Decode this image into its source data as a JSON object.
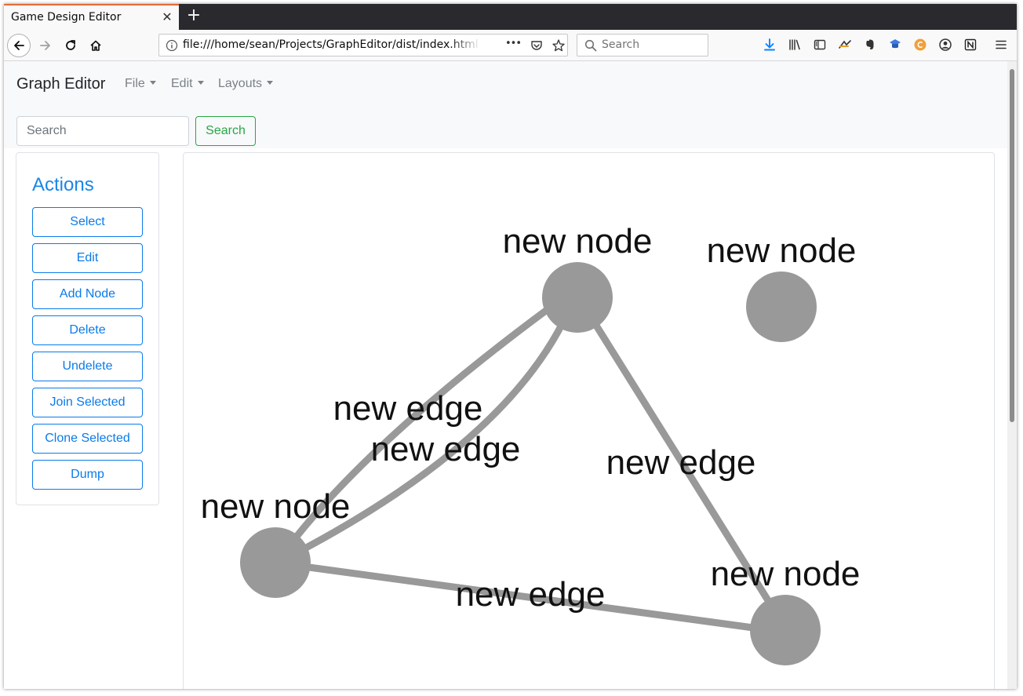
{
  "browser": {
    "tab_title": "Game Design Editor",
    "tab_close": "✕",
    "new_tab": "+",
    "url": "file:///home/sean/Projects/GraphEditor/dist/index.html",
    "page_actions": "•••",
    "search_placeholder": "Search",
    "icons": [
      "back-icon",
      "forward-icon",
      "reload-icon",
      "home-icon",
      "info-icon",
      "pocket-icon",
      "bookmark-star-icon",
      "search-icon",
      "download-icon",
      "library-icon",
      "sidebar-icon",
      "extension-icon",
      "evernote-icon",
      "extension-icon",
      "extension-icon",
      "account-icon",
      "notion-icon",
      "menu-icon"
    ]
  },
  "app": {
    "brand": "Graph Editor",
    "menus": [
      {
        "label": "File"
      },
      {
        "label": "Edit"
      },
      {
        "label": "Layouts"
      }
    ],
    "search": {
      "placeholder": "Search",
      "button_label": "Search"
    },
    "colors": {
      "primary": "#0a7bea",
      "success": "#28a745",
      "node": "#999999",
      "edge": "#999999"
    }
  },
  "sidebar": {
    "title": "Actions",
    "buttons": [
      {
        "label": "Select"
      },
      {
        "label": "Edit"
      },
      {
        "label": "Add Node"
      },
      {
        "label": "Delete"
      },
      {
        "label": "Undelete"
      },
      {
        "label": "Join Selected"
      },
      {
        "label": "Clone Selected"
      },
      {
        "label": "Dump"
      }
    ]
  },
  "graph": {
    "nodes": [
      {
        "id": "n1",
        "label": "new node"
      },
      {
        "id": "n2",
        "label": "new node"
      },
      {
        "id": "n3",
        "label": "new node"
      },
      {
        "id": "n4",
        "label": "new node"
      }
    ],
    "edges": [
      {
        "source": "n3",
        "target": "n1",
        "label": "new edge"
      },
      {
        "source": "n3",
        "target": "n1",
        "label": "new edge"
      },
      {
        "source": "n1",
        "target": "n4",
        "label": "new edge"
      },
      {
        "source": "n3",
        "target": "n4",
        "label": "new edge"
      }
    ]
  }
}
